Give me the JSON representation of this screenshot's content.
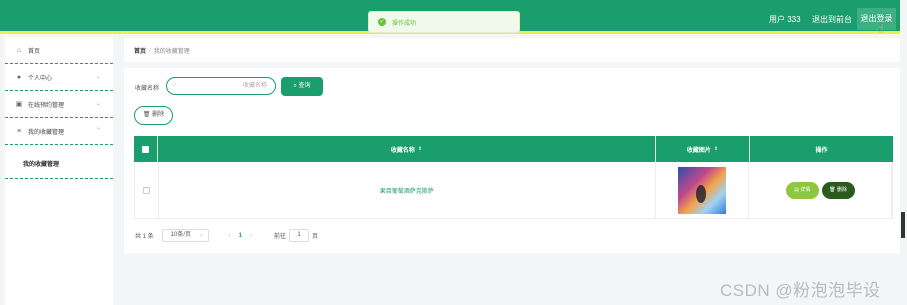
{
  "header": {
    "user_label": "用户 333",
    "to_admin_label": "退出到前台",
    "logout_label": "退出登录"
  },
  "toast": {
    "icon": "check-circle-icon",
    "text": "操作成功"
  },
  "sidebar": {
    "items": [
      {
        "icon": "home-icon",
        "label": "首页"
      },
      {
        "icon": "user-icon",
        "label": "个人中心"
      },
      {
        "icon": "document-icon",
        "label": "在线预约管理"
      },
      {
        "icon": "list-icon",
        "label": "我的收藏管理"
      }
    ],
    "subitem": "我的收藏管理"
  },
  "breadcrumb": {
    "home": "首页",
    "separator": "/",
    "current": "我的收藏管理"
  },
  "search": {
    "label": "收藏名称",
    "placeholder": "收藏名称",
    "query_button": "查询"
  },
  "toolbar": {
    "delete_button": "删除"
  },
  "table": {
    "columns": [
      "收藏名称",
      "收藏图片",
      "操作"
    ],
    "rows": [
      {
        "name": "果目葡萄酒萨克斯萨",
        "actions": {
          "detail": "详情",
          "delete": "删除"
        }
      }
    ]
  },
  "pagination": {
    "total": "共 1 条",
    "page_size": "10条/页",
    "prev": "‹",
    "current_page": "1",
    "next": "›",
    "goto_label": "前往",
    "goto_value": "1",
    "page_unit": "页"
  },
  "watermark": "CSDN @粉泡泡毕设",
  "colors": {
    "primary": "#1a9e6e",
    "accent_yellow": "#e8f24a",
    "detail_btn": "#8dc63f",
    "delete_btn": "#2a5a1e"
  }
}
